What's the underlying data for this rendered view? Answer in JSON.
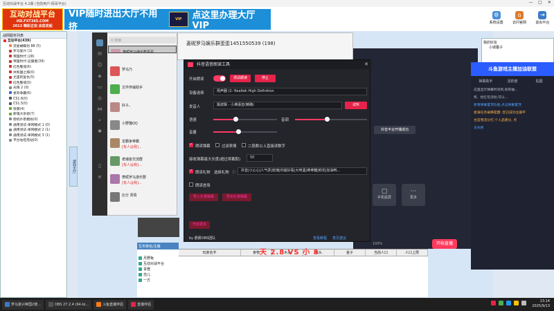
{
  "titlebar": {
    "title": "互动对战平台 4.2版 (当前用户:情哥平台)",
    "controls": [
      "—",
      "□",
      "✕"
    ]
  },
  "logo": {
    "main": "互动对战平台",
    "sub": "HD.FXT365.COM",
    "tag": "2013 精彩正如 由您发起"
  },
  "vipad": {
    "left": "VIP随时进出大厅不用挤",
    "emblem": "VIP",
    "right": "点这里办理大厅VIP"
  },
  "top_toolbar": [
    {
      "label": "系统设置",
      "icon": "gear-icon",
      "color": "#4a90d9"
    },
    {
      "label": "访问官网",
      "icon": "home-icon",
      "color": "#e07b2a"
    },
    {
      "label": "退出平台",
      "icon": "exit-icon",
      "color": "#3a7bc8"
    }
  ],
  "tree": {
    "header": "战网服务列表",
    "items": [
      {
        "label": "互动平台(439)",
        "top": true,
        "color": "#e23"
      },
      {
        "label": "流星蝴蝶剑 88 (5)",
        "color": "#e84"
      },
      {
        "label": "罗马复兴 (1)",
        "color": "#c33"
      },
      {
        "label": "帝国时代 (28)",
        "color": "#c33"
      },
      {
        "label": "帝国时代-征服者(39)",
        "color": "#c33"
      },
      {
        "label": "红色警戒(6)",
        "color": "#c33"
      },
      {
        "label": "共和国之辉(0)",
        "color": "#c33"
      },
      {
        "label": "尤里的复仇(5)",
        "color": "#c33"
      },
      {
        "label": "红色警戒(0)",
        "color": "#c33"
      },
      {
        "label": "光辉 2 (0)",
        "color": "#888"
      },
      {
        "label": "星际争霸(6)",
        "color": "#36c"
      },
      {
        "label": "CS1.6(0)",
        "color": "#555"
      },
      {
        "label": "CS1.5(0)",
        "color": "#555"
      },
      {
        "label": "突袭(4)",
        "color": "#6a3"
      },
      {
        "label": "新魂大杂烩(7)",
        "color": "#6a3"
      },
      {
        "label": "街机扑街模拟(0)",
        "color": "#888"
      },
      {
        "label": "通用测试-单网模式 1 (0)",
        "color": "#888"
      },
      {
        "label": "通用测试-单网模式 2 (1)",
        "color": "#888"
      },
      {
        "label": "通用测试-单网模式 3 (1)",
        "color": "#888"
      },
      {
        "label": "平台站坦克站(0)",
        "color": "#888"
      }
    ]
  },
  "lobbymenu": "游戏大厅",
  "right_friends": {
    "title": "我的好友",
    "item": "小城叠子"
  },
  "wechat": {
    "search": "Q 搜索",
    "chats": [
      {
        "name": "菱昵罗马娱乐群歪歪...",
        "preview": "[动画表情]",
        "time": "",
        "color": "#c9a",
        "selected": true
      },
      {
        "name": "罗马乃",
        "preview": "",
        "time": "",
        "color": "#d55"
      },
      {
        "name": "文件传输助手",
        "preview": "",
        "time": "",
        "color": "#4cae4c"
      },
      {
        "name": "好子。",
        "preview": "",
        "time": "",
        "color": "#b88"
      },
      {
        "name": "小野猫QQ",
        "preview": "",
        "time": "",
        "color": "#888"
      },
      {
        "name": "龙霸争帝霸",
        "preview": "[有人@我]...",
        "time": "",
        "color": "#a86"
      },
      {
        "name": "老魂各交流群",
        "preview": "[有人@我]...",
        "time": "",
        "color": "#696"
      },
      {
        "name": "菱昵罗马游乐群",
        "preview": "[有人@我]...",
        "time": "",
        "color": "#a7a"
      },
      {
        "name": "比分 票情",
        "preview": "",
        "time": "",
        "color": "#777"
      }
    ],
    "chat_title": "菱昵罗马娱乐群歪歪1451550539 (198)"
  },
  "tool": {
    "title": "抖音语音朗读工具",
    "open_read_label": "开启朗读",
    "open_btn_1": "测试朗读",
    "open_btn_2": "停止",
    "device_label": "设备选择",
    "device_value": "扬声器 (2- Realtek High Definition",
    "voice_label": "发音人",
    "voice_value": "飘波飘 - 小满语音(精确)",
    "voice_btn": "试听",
    "speed_label": "语速",
    "pitch_label": "音调",
    "volume_label": "音量",
    "speed": 0.35,
    "pitch": 0.45,
    "volume": 0.4,
    "cb_danmu": "朗读弹幕",
    "cb_filter": "过滤表情",
    "cb_skip": "二段数以上直接读数字",
    "maxlen_label": "接收弹幕最大长度(超过将截取)",
    "maxlen_value": "50",
    "cb_gift": "朗读礼物",
    "gift_select_label": "选择礼物",
    "gift_value": "抖音|小心心|人气票|玫瑰|你最好看|大啤酒|棒棒糖|鲜花|加油鸭...",
    "cb_enter": "朗读进场",
    "btn_a": "导入礼物弹幕",
    "btn_b": "导出礼物弹幕",
    "btn_c": "开启更多",
    "footer_left": "by 爵爵OBS团队",
    "footer_link1": "查看教程",
    "footer_link2": "意见建议"
  },
  "vs_text": "天 2.8  VS  小 8",
  "stream": {
    "cards": [
      "手机投屏",
      "更多"
    ],
    "tip": "抖音平台开播成功",
    "percent": "100%",
    "start_label": "开始直播"
  },
  "dyright": {
    "banner": "斗鱼游戏主播加油联盟",
    "tabs": [
      "弹幕助手",
      "活跃度",
      "贴图"
    ],
    "lines": [
      "这里显示弹幕时间到,如有抽...",
      "奖、抢红包活动,可以...",
      "新增弹幕置顶功能,点击弹幕置顶",
      "星海任务被串提醒: 您已成功注册平",
      "台自我流分打,个人品质分, 点",
      "去兑换"
    ]
  },
  "rank": {
    "title": "互市排名/主播",
    "items": [
      "月野兔",
      "互动对战平台",
      "青橙",
      "范儿",
      "一方"
    ],
    "headers": [
      "玩家名字",
      "食物",
      "木头",
      "石头",
      "金子",
      "当前人口",
      "人口上限"
    ]
  },
  "taskbar": {
    "tasks": [
      {
        "label": "罗马复兴帝国2使...",
        "color": "#3a7bc8"
      },
      {
        "label": "OBS 27.2.4 (64-bi...",
        "color": "#333"
      },
      {
        "label": "斗鱼直播伴侣",
        "color": "#ff7a1a"
      },
      {
        "label": "直播伴侣",
        "color": "#e6234a"
      }
    ],
    "time": "13:14",
    "date": "2025/9/13"
  }
}
